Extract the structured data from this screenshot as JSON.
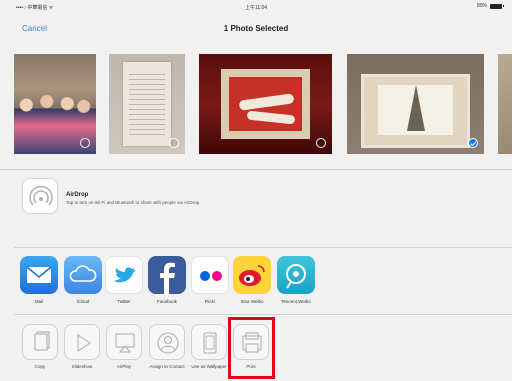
{
  "status_bar": {
    "carrier": "••••○ 中華電信 ᯤ",
    "time": "上午11:04",
    "battery": "80%"
  },
  "nav": {
    "cancel_label": "Cancel",
    "title": "1 Photo Selected"
  },
  "photos": [
    {
      "subject": "group of people",
      "selected": false
    },
    {
      "subject": "document page",
      "selected": false
    },
    {
      "subject": "red painting",
      "selected": false
    },
    {
      "subject": "eiffel tower print",
      "selected": true
    },
    {
      "subject": "partial photo",
      "selected": false
    }
  ],
  "airdrop": {
    "title": "AirDrop",
    "description": "Tap to turn on Wi-Fi and Bluetooth to share with people via AirDrop."
  },
  "share_apps": [
    {
      "label": "Mail",
      "icon": "mail-icon"
    },
    {
      "label": "iCloud",
      "icon": "icloud-icon"
    },
    {
      "label": "Twitter",
      "icon": "twitter-icon"
    },
    {
      "label": "Facebook",
      "icon": "facebook-icon"
    },
    {
      "label": "Flickr",
      "icon": "flickr-icon"
    },
    {
      "label": "Sina Weibo",
      "icon": "sina-weibo-icon"
    },
    {
      "label": "Tencent Weibo",
      "icon": "tencent-weibo-icon"
    }
  ],
  "actions": [
    {
      "label": "Copy",
      "icon": "copy-icon"
    },
    {
      "label": "Slideshow",
      "icon": "play-icon"
    },
    {
      "label": "AirPlay",
      "icon": "airplay-icon"
    },
    {
      "label": "Assign to Contact",
      "icon": "contact-icon"
    },
    {
      "label": "Use as Wallpaper",
      "icon": "wallpaper-icon"
    },
    {
      "label": "Print",
      "icon": "print-icon"
    }
  ],
  "colors": {
    "accent": "#3b7fd6",
    "highlight": "#e2061a",
    "checkmark": "#1a7cf5"
  }
}
